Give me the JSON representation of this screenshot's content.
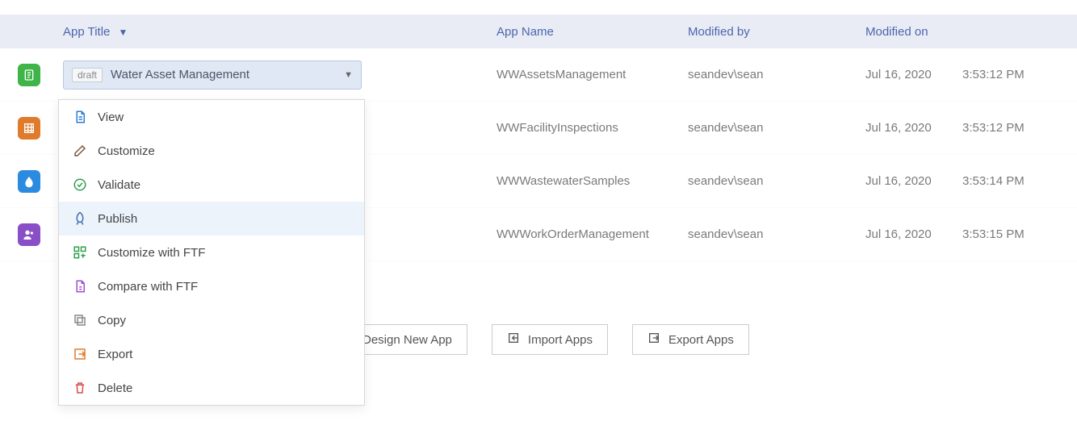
{
  "header": {
    "app_title": "App Title",
    "app_name": "App Name",
    "modified_by": "Modified by",
    "modified_on": "Modified on"
  },
  "rows": [
    {
      "icon_color": "#3fb449",
      "badge": "draft",
      "title": "Water Asset Management",
      "app_name": "WWAssetsManagement",
      "modified_by": "seandev\\sean",
      "modified_date": "Jul 16, 2020",
      "modified_time": "3:53:12 PM"
    },
    {
      "icon_color": "#e07b2c",
      "app_name": "WWFacilityInspections",
      "modified_by": "seandev\\sean",
      "modified_date": "Jul 16, 2020",
      "modified_time": "3:53:12 PM"
    },
    {
      "icon_color": "#2b8be0",
      "app_name": "WWWastewaterSamples",
      "modified_by": "seandev\\sean",
      "modified_date": "Jul 16, 2020",
      "modified_time": "3:53:14 PM"
    },
    {
      "icon_color": "#8a4fc7",
      "app_name": "WWWorkOrderManagement",
      "modified_by": "seandev\\sean",
      "modified_date": "Jul 16, 2020",
      "modified_time": "3:53:15 PM"
    }
  ],
  "menu": {
    "view": "View",
    "customize": "Customize",
    "validate": "Validate",
    "publish": "Publish",
    "customize_ftf": "Customize with FTF",
    "compare_ftf": "Compare with FTF",
    "copy": "Copy",
    "export": "Export",
    "delete": "Delete"
  },
  "actions": {
    "design": "Design New App",
    "import": "Import Apps",
    "export": "Export Apps"
  }
}
